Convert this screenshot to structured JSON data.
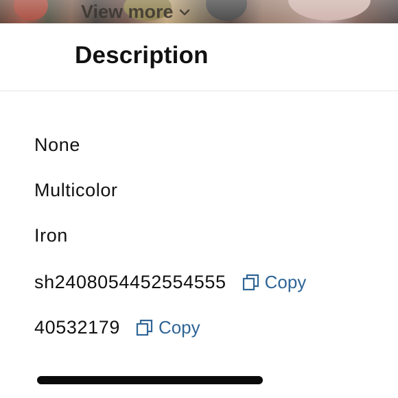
{
  "top": {
    "view_more_label": "View more",
    "chevron_icon": "chevron-down-icon"
  },
  "header": {
    "title": "Description"
  },
  "details": [
    {
      "value": "None"
    },
    {
      "value": "Multicolor"
    },
    {
      "value": "Iron"
    },
    {
      "value": "sh2408054452554555",
      "copy_label": "Copy"
    },
    {
      "value": "40532179",
      "copy_label": "Copy"
    }
  ],
  "colors": {
    "link": "#2f6596",
    "text": "#111111",
    "divider": "#e6e6e6"
  }
}
